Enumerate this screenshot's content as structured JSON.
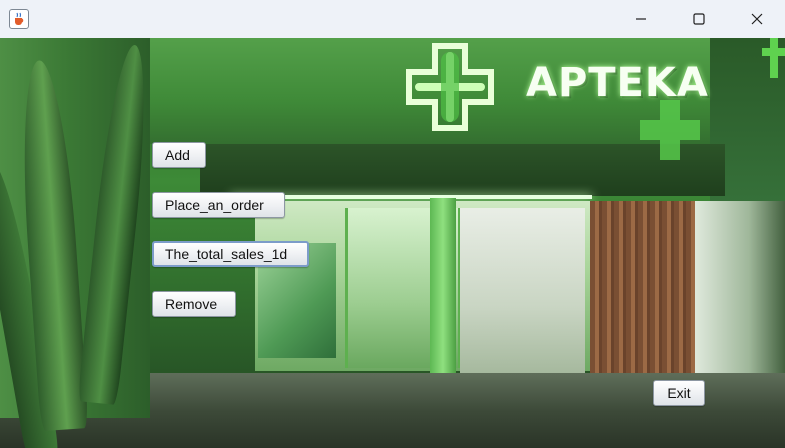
{
  "window": {
    "app_icon": "java-cup-icon",
    "controls": {
      "minimize_icon": "minimize-icon",
      "maximize_icon": "maximize-icon",
      "close_icon": "close-icon"
    }
  },
  "scene": {
    "brand_text": "APTEKA",
    "logo_icon": "pharmacy-cross-logo",
    "accent_color": "#4fbf45"
  },
  "menu": {
    "add_label": "Add",
    "place_order_label": "Place_an_order",
    "total_sales_label": "The_total_sales_1d",
    "remove_label": "Remove"
  },
  "footer": {
    "exit_label": "Exit"
  }
}
